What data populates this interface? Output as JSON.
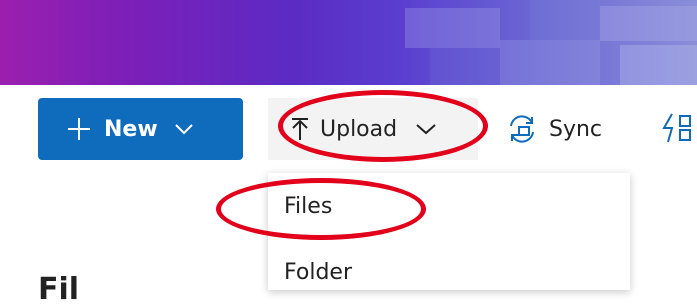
{
  "banner": {
    "color_start": "#9b1fae",
    "color_end": "#8a8ed8"
  },
  "toolbar": {
    "new_label": "New",
    "upload_label": "Upload",
    "sync_label": "Sync",
    "new_color": "#0f6cbd"
  },
  "upload_menu": {
    "items": [
      {
        "label": "Files"
      },
      {
        "label": "Folder"
      }
    ]
  },
  "page": {
    "title": "Fil"
  },
  "annotations": {
    "color": "#e2001a"
  }
}
